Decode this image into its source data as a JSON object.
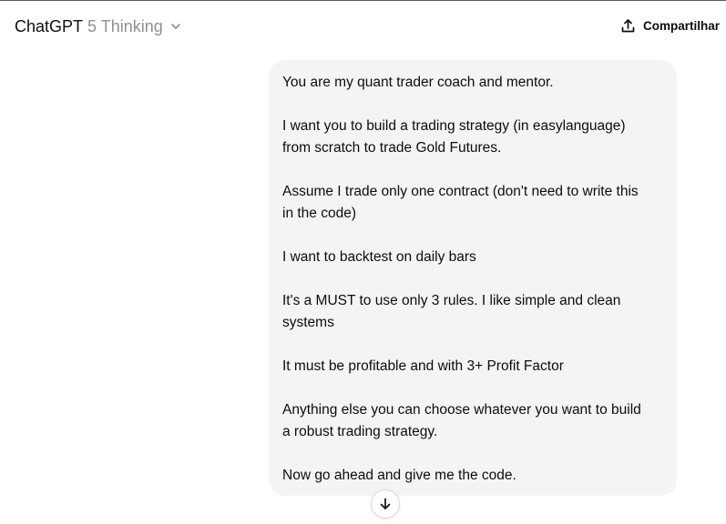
{
  "header": {
    "model_name": "ChatGPT",
    "model_variant": "5 Thinking",
    "chevron_icon": "chevron-down-icon",
    "share_label": "Compartilhar",
    "share_icon": "share-upload-icon"
  },
  "message": {
    "role": "user",
    "lines": [
      "You are my quant trader coach and mentor.",
      "",
      "I want you to build a trading strategy (in easylanguage)",
      "from scratch to trade Gold Futures.",
      "",
      "Assume I trade only one contract (don't need to write this",
      "in the code)",
      "",
      "I want to backtest on daily bars",
      "",
      "It's a MUST to use only 3 rules. I like simple and clean",
      "systems",
      "",
      "It must be profitable and with 3+ Profit Factor",
      "",
      "Anything else you can choose whatever you want to build",
      "a robust trading strategy.",
      "",
      "Now go ahead and give me the code."
    ]
  },
  "scroll_button": {
    "icon": "arrow-down-icon"
  },
  "colors": {
    "bubble_bg": "#f4f4f4",
    "text": "#0d0d0d",
    "muted": "#8f8f8f"
  }
}
